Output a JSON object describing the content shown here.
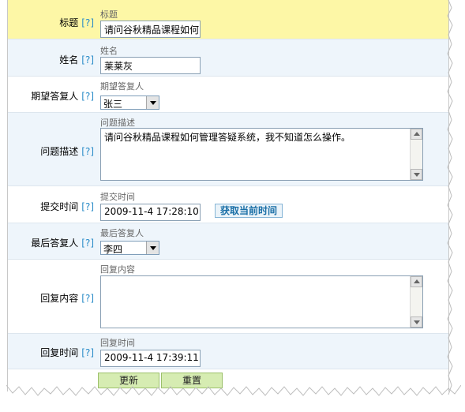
{
  "help_marker": "[?]",
  "fields": {
    "title": {
      "label": "标题",
      "hint": "标题",
      "value": "请问谷秋精品课程如何"
    },
    "name": {
      "label": "姓名",
      "hint": "姓名",
      "value": "莱莱灰"
    },
    "expected_replier": {
      "label": "期望答复人",
      "hint": "期望答复人",
      "selected": "张三"
    },
    "description": {
      "label": "问题描述",
      "hint": "问题描述",
      "value": "请问谷秋精品课程如何管理答疑系统，我不知道怎么操作。"
    },
    "submit_time": {
      "label": "提交时间",
      "hint": "提交时间",
      "value": "2009-11-4 17:28:10",
      "get_time_button": "获取当前时间"
    },
    "last_replier": {
      "label": "最后答复人",
      "hint": "最后答复人",
      "selected": "李四"
    },
    "reply_content": {
      "label": "回复内容",
      "hint": "回复内容",
      "value": ""
    },
    "reply_time": {
      "label": "回复时间",
      "hint": "回复时间",
      "value": "2009-11-4 17:39:11"
    }
  },
  "actions": {
    "update": "更新",
    "reset": "重置"
  },
  "colors": {
    "title_row_bg": "#fdf7a6",
    "alt_row_bg": "#eef5fb",
    "help_link": "#2a8cc8",
    "button_bg": "#d6ecb2"
  }
}
